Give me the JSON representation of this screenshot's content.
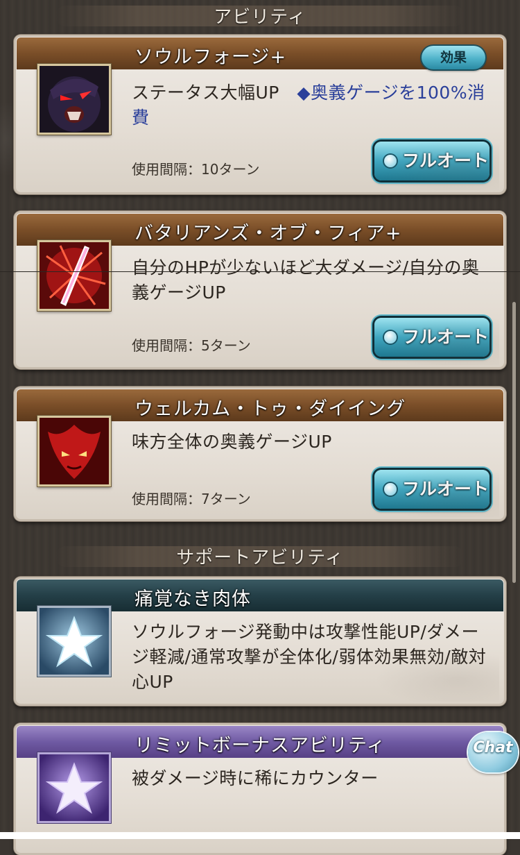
{
  "sections": {
    "abilities": "アビリティ",
    "support": "サポートアビリティ"
  },
  "abilities": [
    {
      "name": "ソウルフォージ+",
      "desc_main": "ステータス大幅UP　",
      "desc_hl": "◆奥義ゲージを100%消費",
      "interval": "使用間隔：10ターン",
      "effect_label": "効果",
      "auto_label": "フルオート",
      "icon": "dark-warrior-portrait-icon"
    },
    {
      "name": "バタリアンズ・オブ・フィア+",
      "desc_main": "自分のHPが少ないほど大ダメージ/自分の奥義ゲージUP",
      "interval": "使用間隔：5ターン",
      "auto_label": "フルオート",
      "icon": "red-slash-icon"
    },
    {
      "name": "ウェルカム・トゥ・ダイイング",
      "desc_main": "味方全体の奥義ゲージUP",
      "interval": "使用間隔：7ターン",
      "auto_label": "フルオート",
      "icon": "red-demon-face-icon"
    }
  ],
  "support_abilities": [
    {
      "name": "痛覚なき肉体",
      "desc_main": "ソウルフォージ発動中は攻撃性能UP/ダメージ軽減/通常攻撃が全体化/弱体効果無効/敵対心UP",
      "icon": "blue-star-icon"
    },
    {
      "name": "リミットボーナスアビリティ",
      "desc_main": "被ダメージ時に稀にカウンター",
      "icon": "purple-star-icon"
    }
  ],
  "chat": {
    "label": "Chat"
  },
  "colors": {
    "header_brown": "#7a4e28",
    "header_teal": "#243f47",
    "header_purple": "#6f5aa3",
    "highlight_text": "#2a3f9a",
    "auto_button": "#3fa6c0"
  }
}
